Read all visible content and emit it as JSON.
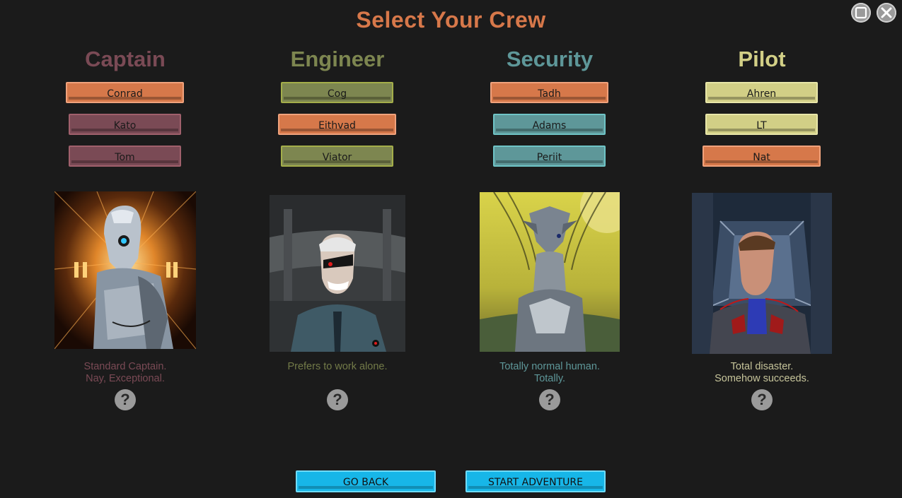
{
  "title": "Select Your Crew",
  "window_controls": {
    "maximize_icon": "square-icon",
    "close_icon": "x-icon"
  },
  "colors": {
    "selected": "#d6784a",
    "captain": "#7a4a55",
    "engineer": "#7d8650",
    "security": "#5e9799",
    "pilot": "#d2cf86",
    "action_button": "#17b6e8"
  },
  "columns": [
    {
      "role": "Captain",
      "crew": [
        "Conrad",
        "Kato",
        "Tom"
      ],
      "selected": "Conrad",
      "description": [
        "Standard Captain.",
        "Nay, Exceptional."
      ],
      "portrait": "cyborg-captain-portrait"
    },
    {
      "role": "Engineer",
      "crew": [
        "Cog",
        "Eithvad",
        "Viator"
      ],
      "selected": "Eithvad",
      "description": [
        "Prefers to work alone.",
        ""
      ],
      "portrait": "old-eyepatch-engineer-portrait"
    },
    {
      "role": "Security",
      "crew": [
        "Tadh",
        "Adams",
        "Periit"
      ],
      "selected": "Tadh",
      "description": [
        "Totally normal human.",
        "Totally."
      ],
      "portrait": "alien-security-portrait"
    },
    {
      "role": "Pilot",
      "crew": [
        "Ahren",
        "LT",
        "Nat"
      ],
      "selected": "Nat",
      "description": [
        "Total disaster.",
        "Somehow succeeds."
      ],
      "portrait": "human-pilot-portrait"
    }
  ],
  "help_label": "?",
  "buttons": {
    "back": "GO BACK",
    "start": "START ADVENTURE"
  }
}
